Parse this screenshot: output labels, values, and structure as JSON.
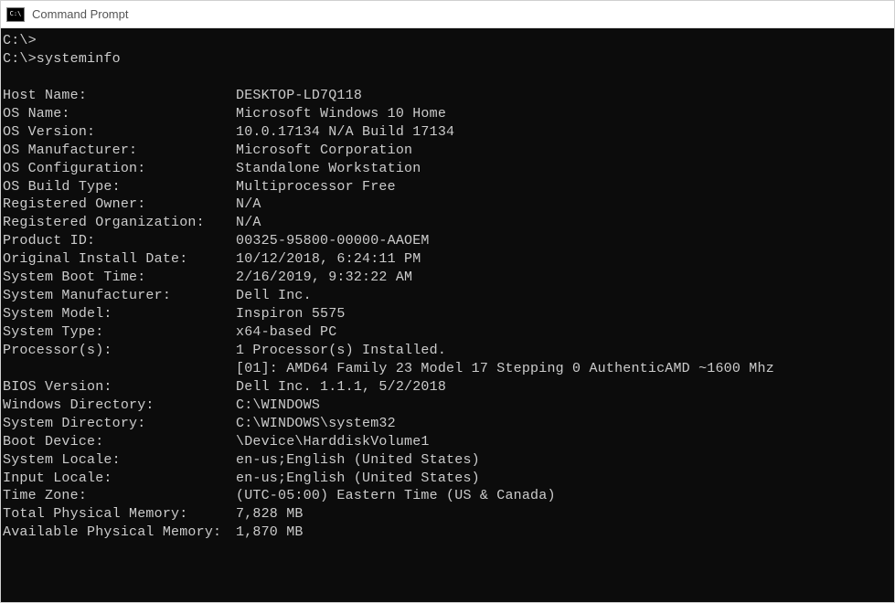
{
  "window": {
    "title": "Command Prompt"
  },
  "prompts": [
    "C:\\>",
    "C:\\>systeminfo"
  ],
  "rows": [
    {
      "label": "Host Name:",
      "value": "DESKTOP-LD7Q118"
    },
    {
      "label": "OS Name:",
      "value": "Microsoft Windows 10 Home"
    },
    {
      "label": "OS Version:",
      "value": "10.0.17134 N/A Build 17134"
    },
    {
      "label": "OS Manufacturer:",
      "value": "Microsoft Corporation"
    },
    {
      "label": "OS Configuration:",
      "value": "Standalone Workstation"
    },
    {
      "label": "OS Build Type:",
      "value": "Multiprocessor Free"
    },
    {
      "label": "Registered Owner:",
      "value": "N/A"
    },
    {
      "label": "Registered Organization:",
      "value": "N/A"
    },
    {
      "label": "Product ID:",
      "value": "00325-95800-00000-AAOEM"
    },
    {
      "label": "Original Install Date:",
      "value": "10/12/2018, 6:24:11 PM"
    },
    {
      "label": "System Boot Time:",
      "value": "2/16/2019, 9:32:22 AM"
    },
    {
      "label": "System Manufacturer:",
      "value": "Dell Inc."
    },
    {
      "label": "System Model:",
      "value": "Inspiron 5575"
    },
    {
      "label": "System Type:",
      "value": "x64-based PC"
    },
    {
      "label": "Processor(s):",
      "value": "1 Processor(s) Installed."
    }
  ],
  "processor_detail": "[01]: AMD64 Family 23 Model 17 Stepping 0 AuthenticAMD ~1600 Mhz",
  "rows2": [
    {
      "label": "BIOS Version:",
      "value": "Dell Inc. 1.1.1, 5/2/2018"
    },
    {
      "label": "Windows Directory:",
      "value": "C:\\WINDOWS"
    },
    {
      "label": "System Directory:",
      "value": "C:\\WINDOWS\\system32"
    },
    {
      "label": "Boot Device:",
      "value": "\\Device\\HarddiskVolume1"
    },
    {
      "label": "System Locale:",
      "value": "en-us;English (United States)"
    },
    {
      "label": "Input Locale:",
      "value": "en-us;English (United States)"
    },
    {
      "label": "Time Zone:",
      "value": "(UTC-05:00) Eastern Time (US & Canada)"
    },
    {
      "label": "Total Physical Memory:",
      "value": "7,828 MB"
    },
    {
      "label": "Available Physical Memory:",
      "value": "1,870 MB"
    }
  ]
}
